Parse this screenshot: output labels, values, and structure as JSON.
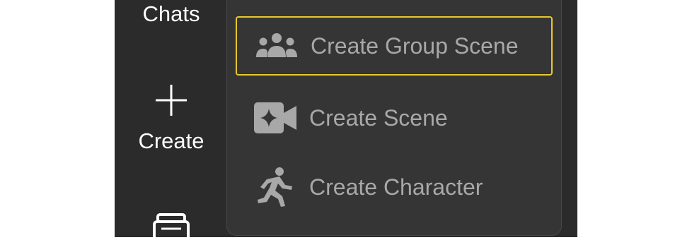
{
  "nav": {
    "chats_label": "Chats",
    "create_label": "Create"
  },
  "menu": {
    "items": [
      {
        "label": "Create Group Scene",
        "icon": "group-icon",
        "selected": true
      },
      {
        "label": "Create Scene",
        "icon": "video-sparkle-icon",
        "selected": false
      },
      {
        "label": "Create Character",
        "icon": "running-person-icon",
        "selected": false
      }
    ]
  },
  "colors": {
    "sidebar_bg": "#2b2b2b",
    "menu_bg": "#353535",
    "selection_border": "#e8c82e",
    "menu_text": "#a8a8a8"
  }
}
